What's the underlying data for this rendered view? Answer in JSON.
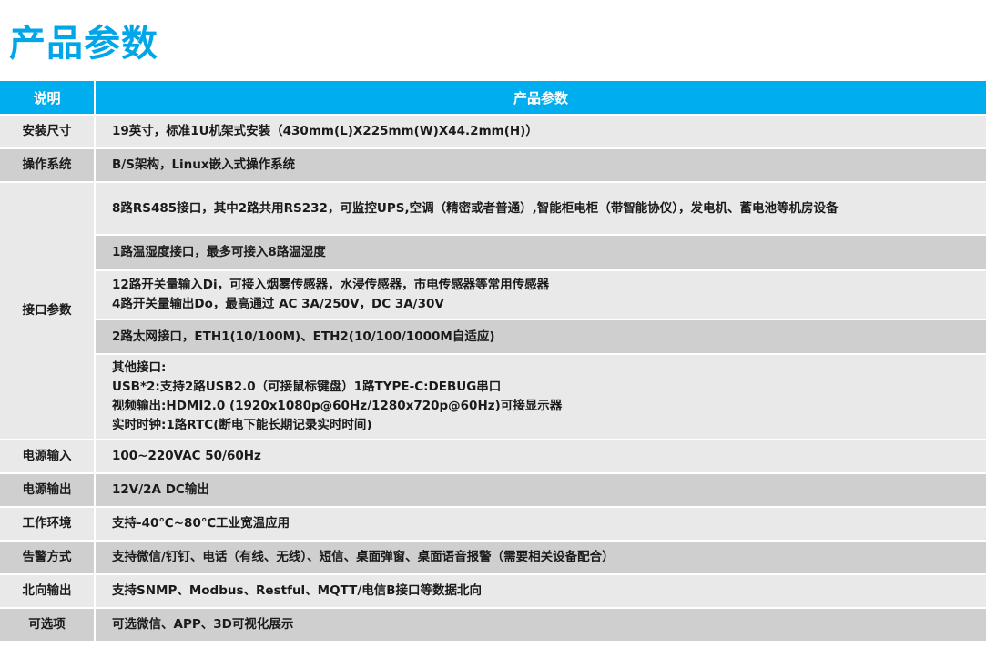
{
  "page_title": "产品参数",
  "header": {
    "col1": "说明",
    "col2": "产品参数"
  },
  "rows": [
    {
      "label": "安装尺寸",
      "value": "19英寸，标准1U机架式安装（430mm(L)X225mm(W)X44.2mm(H)）"
    },
    {
      "label": "操作系统",
      "value": "B/S架构，Linux嵌入式操作系统"
    },
    {
      "label": "接口参数",
      "subs": [
        [
          "8路RS485接口，其中2路共用RS232，可监控UPS,空调（精密或者普通）,智能柜电柜（带智能协仪），发电机、蓄电池等机房设备"
        ],
        [
          "1路温湿度接口，最多可接入8路温湿度"
        ],
        [
          "12路开关量输入Di，可接入烟雾传感器，水浸传感器，市电传感器等常用传感器",
          "4路开关量输出Do，最高通过 AC 3A/250V，DC 3A/30V"
        ],
        [
          "2路太网接口，ETH1(10/100M)、ETH2(10/100/1000M自适应)"
        ],
        [
          "其他接口:",
          "USB*2:支持2路USB2.0（可接鼠标键盘）1路TYPE-C:DEBUG串口",
          "视频输出:HDMI2.0 (1920x1080p@60Hz/1280x720p@60Hz)可接显示器",
          "实时时钟:1路RTC(断电下能长期记录实时时间)"
        ]
      ]
    },
    {
      "label": "电源输入",
      "value": "100~220VAC 50/60Hz"
    },
    {
      "label": "电源输出",
      "value": "12V/2A DC输出"
    },
    {
      "label": "工作环境",
      "value": "支持-40℃~80℃工业宽温应用"
    },
    {
      "label": "告警方式",
      "value": "支持微信/钉钉、电话（有线、无线）、短信、桌面弹窗、桌面语音报警（需要相关设备配合）"
    },
    {
      "label": "北向输出",
      "value": "支持SNMP、Modbus、Restful、MQTT/电信B接口等数据北向"
    },
    {
      "label": "可选项",
      "value": "可选微信、APP、3D可视化展示"
    }
  ]
}
